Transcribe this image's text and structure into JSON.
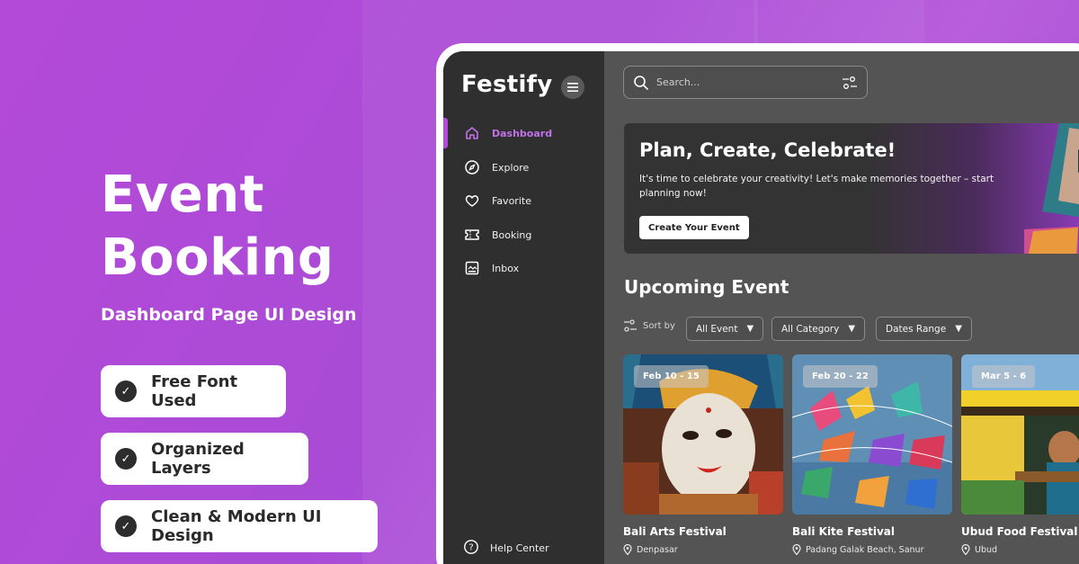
{
  "hero": {
    "title_line1": "Event",
    "title_line2": "Booking",
    "subtitle": "Dashboard Page UI Design",
    "features": [
      "Free Font Used",
      "Organized Layers",
      "Clean & Modern UI Design"
    ]
  },
  "app": {
    "logo": "Festify",
    "nav": [
      {
        "label": "Dashboard",
        "icon": "home-icon",
        "active": true
      },
      {
        "label": "Explore",
        "icon": "compass-icon",
        "active": false
      },
      {
        "label": "Favorite",
        "icon": "heart-icon",
        "active": false
      },
      {
        "label": "Booking",
        "icon": "ticket-icon",
        "active": false
      },
      {
        "label": "Inbox",
        "icon": "inbox-icon",
        "active": false
      }
    ],
    "help": "Help Center",
    "search": {
      "placeholder": "Search..."
    },
    "banner": {
      "title": "Plan, Create, Celebrate!",
      "text": "It's time to celebrate your creativity! Let's make memories together – start planning now!",
      "button": "Create Your Event"
    },
    "section_title": "Upcoming Event",
    "sort_label": "Sort by",
    "filters": [
      "All Event",
      "All Category",
      "Dates Range"
    ],
    "events": [
      {
        "date": "Feb 10 - 15",
        "name": "Bali Arts Festival",
        "location": "Denpasar"
      },
      {
        "date": "Feb 20 - 22",
        "name": "Bali Kite Festival",
        "location": "Padang Galak Beach, Sanur"
      },
      {
        "date": "Mar 5 - 6",
        "name": "Ubud Food Festival",
        "location": "Ubud"
      }
    ],
    "colors": {
      "accent": "#b44ad8",
      "sidebar": "#2f2f2f",
      "main": "#545454"
    }
  }
}
